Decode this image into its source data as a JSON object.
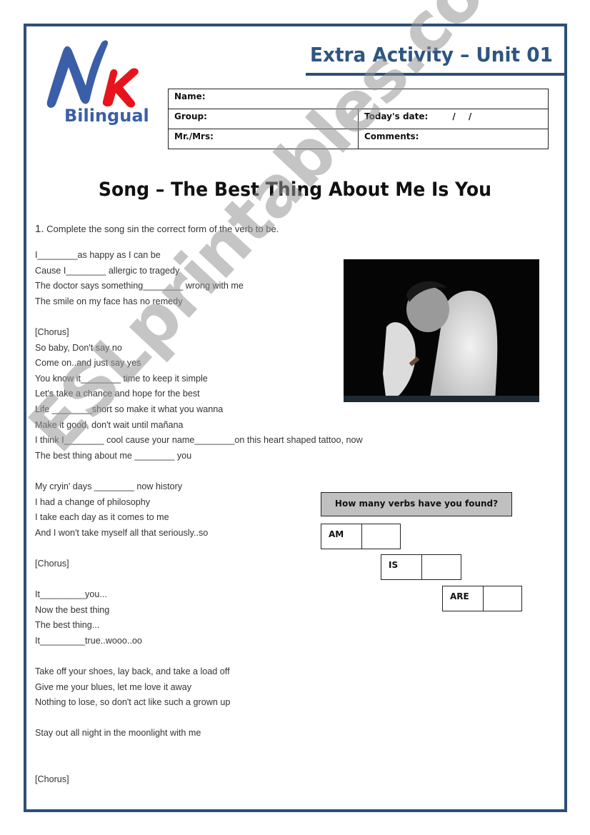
{
  "header": {
    "logo": {
      "main_letters_n": "N",
      "main_letters_k": "K",
      "subtitle": "Bilingual",
      "colors": {
        "n": "#3a5ea8",
        "k": "#e8141c",
        "subtitle": "#3a5ea8"
      }
    },
    "title": "Extra Activity – Unit 01",
    "title_color": "#2e5580",
    "frame_color": "#2c4f77"
  },
  "info_table": {
    "name_label": "Name:",
    "group_label": "Group:",
    "date_label": "Today's date:",
    "date_value": "/ /",
    "teacher_label": "Mr./Mrs:",
    "comments_label": "Comments:"
  },
  "song_title": "Song – The Best Thing About Me Is You",
  "instruction": {
    "number": "1.",
    "text": " Complete the song sin the correct form of the verb to be."
  },
  "lyrics": [
    "I________as happy as I can be",
    "Cause I________ allergic to tragedy",
    "The doctor says something________ wrong with me",
    "The smile on my face has no remedy",
    "",
    "[Chorus]",
    "So baby, Don't say no",
    "Come on..and just say yes",
    "You know it________ time to keep it simple",
    "Let's take a chance and hope for the best",
    "Life ________short so make it what you wanna",
    "Make it good, don't wait until mañana",
    "I think I________ cool cause your name________on this heart shaped tattoo, now",
    "The best thing about me ________ you",
    "",
    "My cryin' days ________ now history",
    "I had a change of philosophy",
    "I take each day as it comes to me",
    "And I won't take myself all that seriously..so",
    "",
    "[Chorus]",
    "",
    "It_________you...",
    "Now the best thing",
    "The best thing...",
    "It_________true..wooo..oo",
    "",
    "Take off your shoes, lay back, and take a load off",
    "Give me your blues, let me love it away",
    "Nothing to lose, so don't act like such a grown up",
    "",
    "Stay out all night in the moonlight with me",
    "",
    "",
    "[Chorus]"
  ],
  "photo": {
    "description": "Black and white photo of a man in a white hooded jacket with hands clasped near his face"
  },
  "verbs_panel": {
    "question": "How many verbs have you found?",
    "boxes": [
      {
        "label": "AM",
        "value": ""
      },
      {
        "label": "IS",
        "value": ""
      },
      {
        "label": "ARE",
        "value": ""
      }
    ]
  },
  "watermark": "ESLprintables.com"
}
